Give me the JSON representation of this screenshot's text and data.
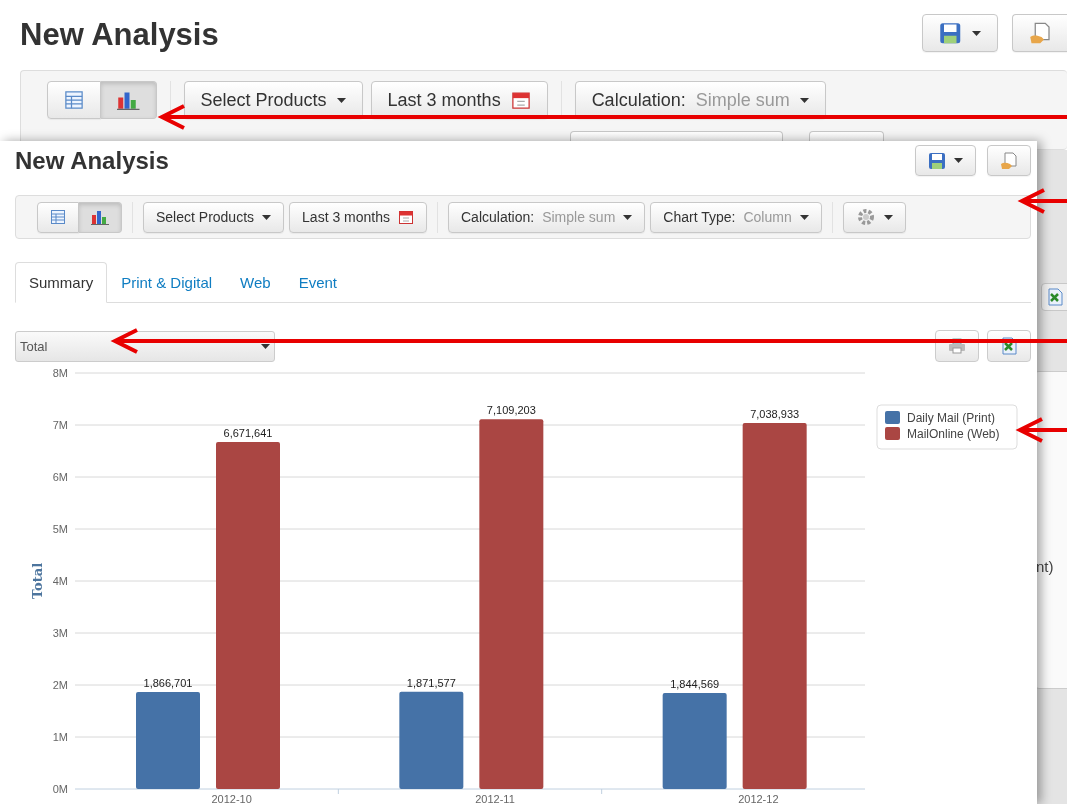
{
  "background_page": {
    "title": "New Analysis",
    "toolbar": {
      "view_toggle": [
        {
          "kind": "table",
          "selected": false
        },
        {
          "kind": "chart",
          "selected": true
        }
      ],
      "buttons": [
        {
          "kind": "dropdown",
          "label": "Select Products"
        },
        {
          "kind": "date",
          "label": "Last 3 months"
        },
        {
          "kind": "dropdown",
          "label": "Calculation:",
          "value": "Simple sum"
        }
      ]
    },
    "fragment": "nt)"
  },
  "window": {
    "title": "New Analysis",
    "toolbar": {
      "view_toggle": [
        {
          "kind": "table",
          "selected": false
        },
        {
          "kind": "chart",
          "selected": true
        }
      ],
      "buttons": [
        {
          "kind": "dropdown",
          "label": "Select Products"
        },
        {
          "kind": "date",
          "label": "Last 3 months"
        },
        {
          "kind": "dropdown",
          "label": "Calculation:",
          "value": "Simple sum"
        },
        {
          "kind": "dropdown",
          "label": "Chart Type:",
          "value": "Column"
        },
        {
          "kind": "settings"
        }
      ]
    },
    "tabs": [
      {
        "label": "Summary",
        "selected": true
      },
      {
        "label": "Print & Digital",
        "selected": false
      },
      {
        "label": "Web",
        "selected": false
      },
      {
        "label": "Event",
        "selected": false
      }
    ],
    "measure_select": {
      "value": "Total"
    },
    "chart_data": {
      "type": "bar",
      "ylabel": "Total",
      "categories": [
        "2012-10",
        "2012-11",
        "2012-12"
      ],
      "series": [
        {
          "name": "Daily Mail (Print)",
          "color": "#4572a7",
          "values": [
            1866701,
            1871577,
            1844569
          ]
        },
        {
          "name": "MailOnline (Web)",
          "color": "#aa4643",
          "values": [
            6671641,
            7109203,
            7038933
          ]
        }
      ],
      "ylim": [
        0,
        8000000
      ],
      "yticks": [
        {
          "value": 0,
          "label": "0M"
        },
        {
          "value": 1000000,
          "label": "1M"
        },
        {
          "value": 2000000,
          "label": "2M"
        },
        {
          "value": 3000000,
          "label": "3M"
        },
        {
          "value": 4000000,
          "label": "4M"
        },
        {
          "value": 5000000,
          "label": "5M"
        },
        {
          "value": 6000000,
          "label": "6M"
        },
        {
          "value": 7000000,
          "label": "7M"
        },
        {
          "value": 8000000,
          "label": "8M"
        }
      ],
      "value_labels": [
        [
          "1,866,701",
          "1,871,577",
          "1,844,569"
        ],
        [
          "6,671,641",
          "7,109,203",
          "7,038,933"
        ]
      ],
      "grid": true,
      "legend": true
    }
  }
}
